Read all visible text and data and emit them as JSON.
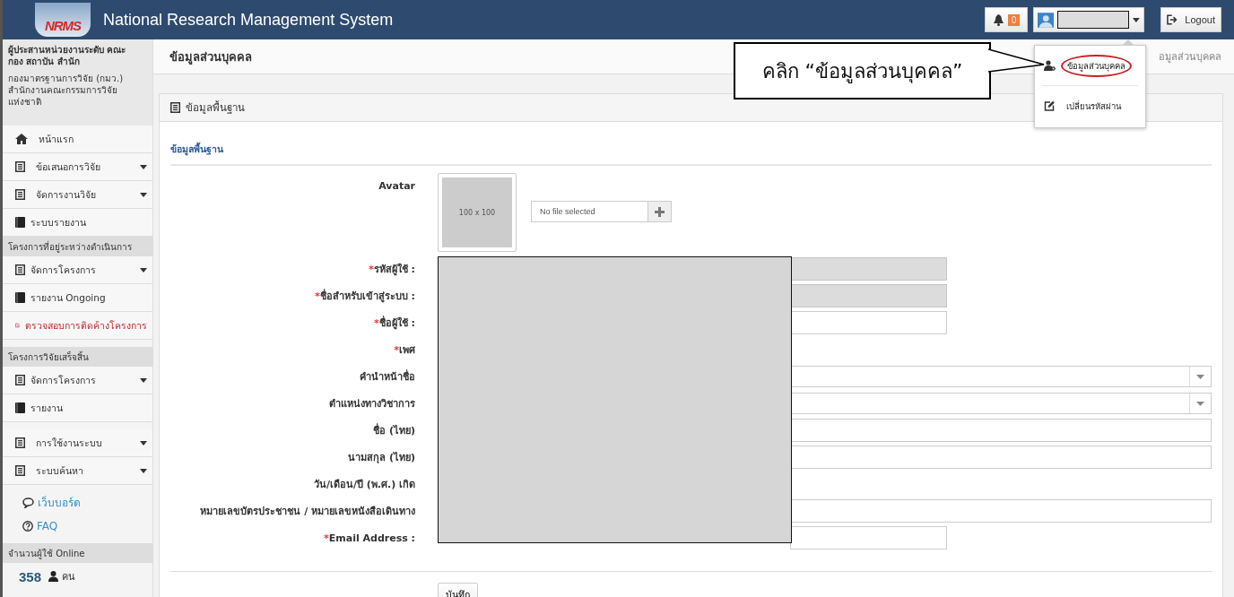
{
  "header": {
    "logo": "NRMS",
    "title": "National Research Management System",
    "notifications": "0",
    "user": {
      "redacted": true
    },
    "logout": "Logout"
  },
  "user_menu": {
    "items": [
      {
        "kind": "profile",
        "label": "ข้อมูลส่วนบุคคล",
        "circled": true
      },
      {
        "kind": "password",
        "label": "เปลี่ยนรหัสผ่าน",
        "circled": false
      }
    ]
  },
  "callout": {
    "text": "คลิก “ข้อมูลส่วนบุคคล”"
  },
  "sidebar": {
    "role": "ผู้ประสานหน่วยงานระดับ คณะ กอง สถาบัน สำนัก",
    "organization": "กองมาตรฐานการวิจัย (กมว.) สำนักงานคณะกรรมการวิจัยแห่งชาติ",
    "groups": [
      {
        "items": [
          {
            "kind": "home",
            "label": "หน้าแรก",
            "has_submenu": false
          },
          {
            "kind": "form",
            "label": "ข้อเสนอการวิจัย",
            "has_submenu": true
          },
          {
            "kind": "form",
            "label": "จัดการงานวิจัย",
            "has_submenu": true
          },
          {
            "kind": "book",
            "label": "ระบบรายงาน",
            "has_submenu": false
          }
        ]
      },
      {
        "heading": "โครงการที่อยู่ระหว่างดำเนินการ",
        "items": [
          {
            "kind": "form",
            "label": "จัดการโครงการ",
            "has_submenu": true
          },
          {
            "kind": "book",
            "label": "รายงาน Ongoing",
            "has_submenu": false
          },
          {
            "kind": "alert",
            "label": "ตรวจสอบการติดค้างโครงการ",
            "has_submenu": false
          }
        ]
      },
      {
        "heading": "โครงการวิจัยเสร็จสิ้น",
        "items": [
          {
            "kind": "form",
            "label": "จัดการโครงการ",
            "has_submenu": true
          },
          {
            "kind": "book",
            "label": "รายงาน",
            "has_submenu": false
          }
        ]
      },
      {
        "items": [
          {
            "kind": "form",
            "label": "การใช้งานระบบ",
            "has_submenu": true
          },
          {
            "kind": "form",
            "label": "ระบบค้นหา",
            "has_submenu": true
          }
        ]
      }
    ],
    "links": [
      {
        "kind": "chat",
        "label": "เว็บบอร์ด"
      },
      {
        "kind": "help",
        "label": "FAQ"
      }
    ],
    "online": {
      "heading": "จำนวนผู้ใช้ Online",
      "count": "358",
      "unit": "คน"
    }
  },
  "page": {
    "title": "ข้อมูลส่วนบุคคล",
    "breadcrumb": "อมูลส่วนบุคคล"
  },
  "panel": {
    "title": "ข้อมูลพื้นฐาน",
    "section": "ข้อมูลพื้นฐาน",
    "avatar": {
      "label": "Avatar",
      "placeholder_text": "100 x 100",
      "file_placeholder": "No file selected"
    },
    "redacted": true,
    "fields": [
      {
        "kind": "short",
        "label": "รหัสผู้ใช้ :",
        "required_mark": "*",
        "disabled": true
      },
      {
        "kind": "short",
        "label": "ชื่อสำหรับเข้าสู่ระบบ :",
        "required_mark": "*",
        "disabled": true
      },
      {
        "kind": "short",
        "label": "ชื่อผู้ใช้ :",
        "required_mark": "*",
        "disabled": false
      },
      {
        "kind": "none",
        "label": "เพศ",
        "required_mark": "*"
      },
      {
        "kind": "select",
        "label": "คำนำหน้าชื่อ"
      },
      {
        "kind": "select",
        "label": "ตำแหน่งทางวิชาการ"
      },
      {
        "kind": "long",
        "label": "ชื่อ (ไทย)",
        "disabled": false
      },
      {
        "kind": "long",
        "label": "นามสกุล (ไทย)",
        "disabled": false
      },
      {
        "kind": "none",
        "label": "วัน/เดือน/ปี (พ.ศ.) เกิด"
      },
      {
        "kind": "long",
        "label": "หมายเลขบัตรประชาชน / หมายเลขหนังสือเดินทาง",
        "disabled": false
      },
      {
        "kind": "short",
        "label": "Email Address :",
        "required_mark": "*",
        "disabled": false
      }
    ],
    "save": "บันทึก"
  }
}
